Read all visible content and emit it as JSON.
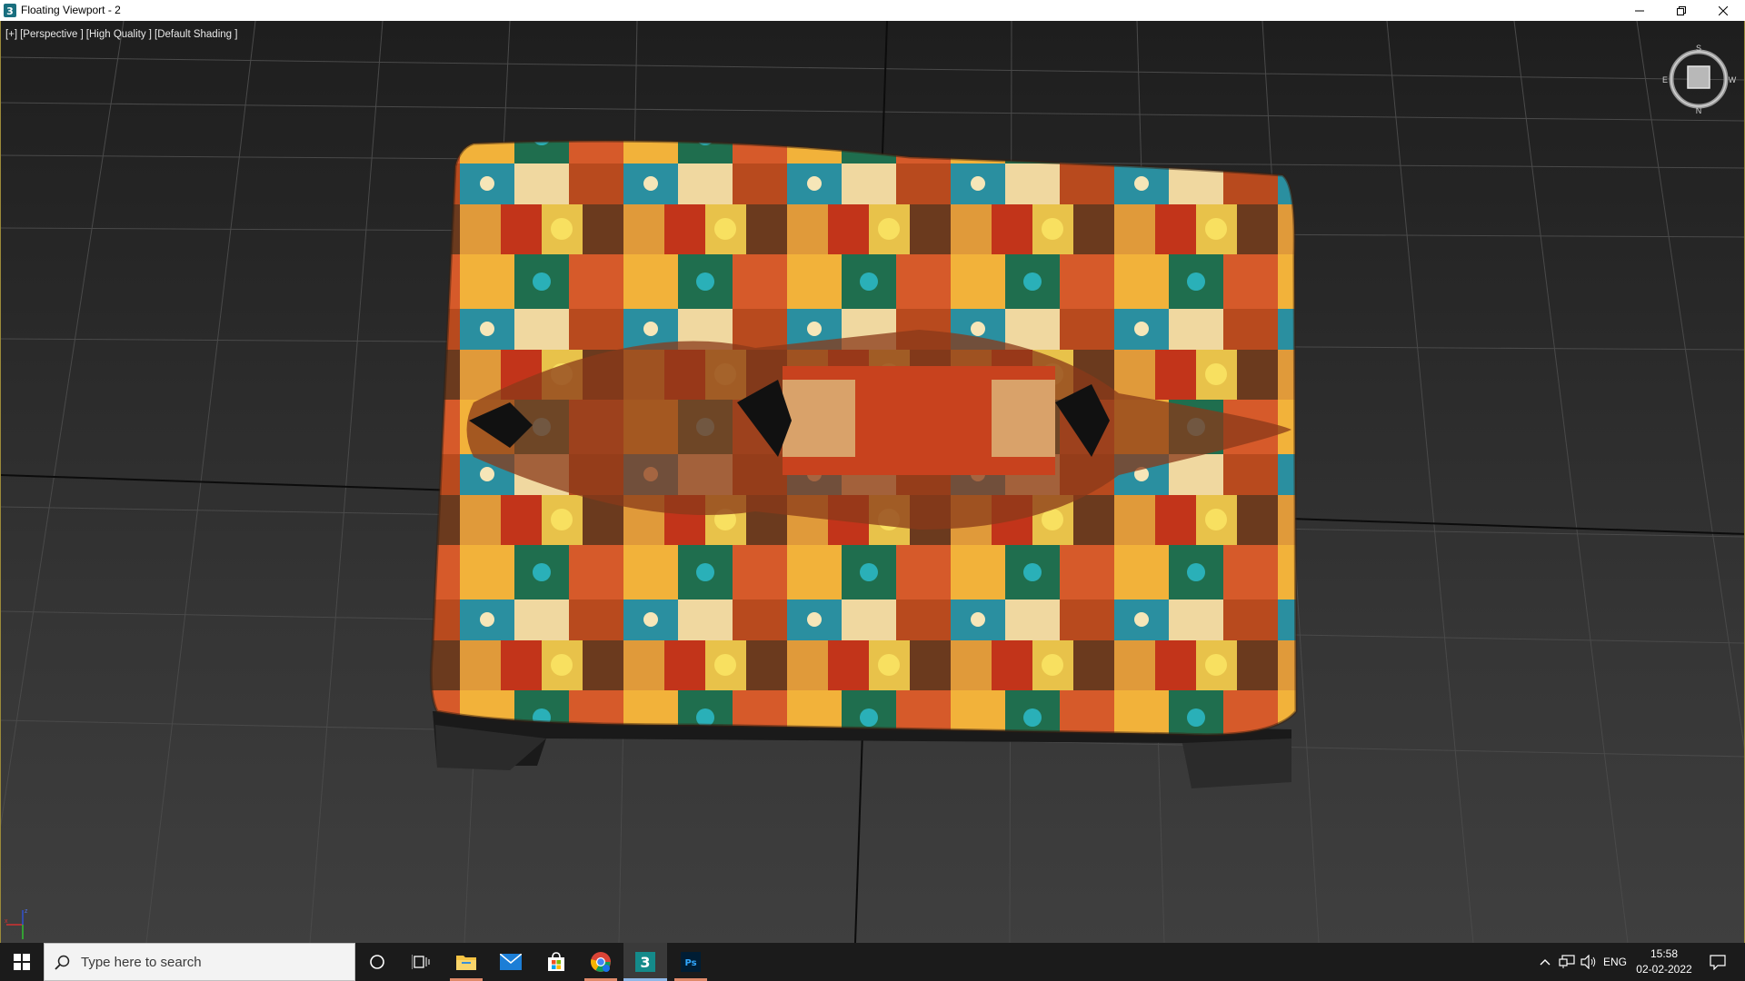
{
  "window": {
    "title": "Floating Viewport - 2"
  },
  "viewport": {
    "labels": [
      "[+]",
      "[Perspective ]",
      "[High Quality ]",
      "[Default Shading ]"
    ],
    "viewcube_faces": {
      "top": "S",
      "bottom": "N",
      "left": "E",
      "right": "W"
    },
    "axis": {
      "x": "x",
      "z": "z"
    }
  },
  "taskbar": {
    "search_placeholder": "Type here to search",
    "lang": "ENG",
    "time": "15:58",
    "date": "02-02-2022",
    "apps": [
      "file-explorer",
      "mail",
      "microsoft-store",
      "chrome",
      "3ds-max",
      "photoshop"
    ]
  },
  "colors": {
    "accent_border": "#9b8a3a",
    "taskbar": "#1b1b1b",
    "viewport_top": "#1e1e1e",
    "viewport_bottom": "#3f3f3f"
  }
}
